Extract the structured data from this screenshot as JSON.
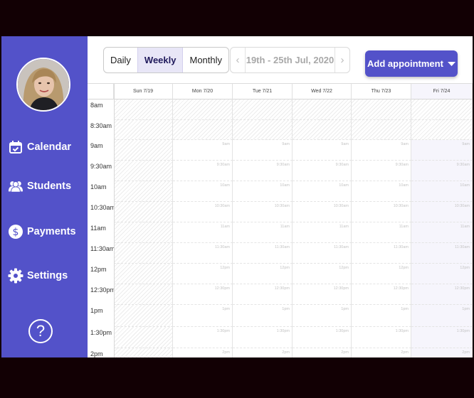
{
  "sidebar": {
    "items": [
      {
        "label": "Calendar",
        "icon": "calendar-check-icon"
      },
      {
        "label": "Students",
        "icon": "users-icon"
      },
      {
        "label": "Payments",
        "icon": "dollar-circle-icon"
      },
      {
        "label": "Settings",
        "icon": "gear-icon"
      }
    ],
    "help": "?"
  },
  "toolbar": {
    "views": [
      "Daily",
      "Weekly",
      "Monthly"
    ],
    "active_view": "Weekly",
    "date_range": "19th - 25th Jul, 2020",
    "add_label": "Add appointment"
  },
  "calendar": {
    "days": [
      "Sun 7/19",
      "Mon 7/20",
      "Tue 7/21",
      "Wed 7/22",
      "Thu 7/23",
      "Fri 7/24"
    ],
    "times": [
      "8am",
      "8:30am",
      "9am",
      "9:30am",
      "10am",
      "10:30am",
      "11am",
      "11:30am",
      "12pm",
      "12:30pm",
      "1pm",
      "1:30pm",
      "2pm"
    ]
  },
  "colors": {
    "brand": "#5352c9",
    "active_tab_bg": "#e8e6f7",
    "frame": "#120004"
  }
}
